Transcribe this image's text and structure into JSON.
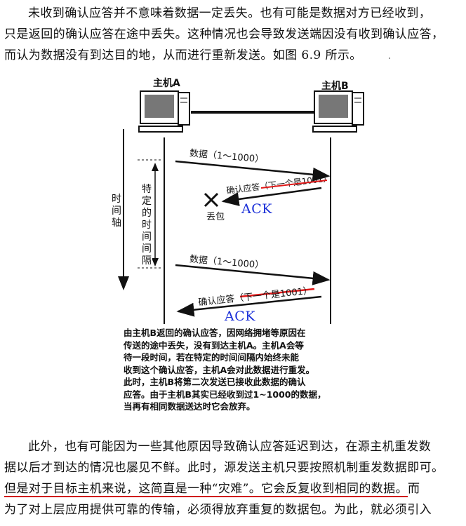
{
  "paragraph1": {
    "lines": [
      "未收到确认应答并不意味着数据一定丢失。也有可能是数据对方已经收到，",
      "只是返回的确认应答在途中丢失。这种情况也会导致发送端因没有收到确认应答，",
      "而认为数据没有到达目的地，从而进行重新发送。如图 6.9 所示。"
    ]
  },
  "diagram": {
    "host_a": "主机A",
    "host_b": "主机B",
    "time_axis": [
      "时",
      "间",
      "轴"
    ],
    "interval": [
      "特",
      "定",
      "的",
      "时",
      "间",
      "间",
      "隔"
    ],
    "data1": "数据（1～1000）",
    "ack1": "确认应答（下一个是1001）",
    "lost": "丢包",
    "ack_note1": "ACK",
    "data2": "数据（1～1000）",
    "ack2": "确认应答（下一个是1001）",
    "ack_note2": "ACK",
    "ack_color": "#1a2fd8",
    "strike_color": "#e01818"
  },
  "caption": {
    "lines": [
      "由主机B返回的确认应答，因网络拥堵等原因在",
      "传送的途中丢失，没有到达主机A。主机A会等",
      "待一段时间，若在特定的时间间隔内始终未能",
      "收到这个确认应答，主机A会对此数据进行重发。",
      "此时，主机B将第二次发送已接收此数据的确认",
      "应答。由于主机B其实已经收到过1~1000的数据，",
      "当再有相同数据送达时它会放弃。"
    ]
  },
  "paragraph2": {
    "line1": "此外，也有可能因为一些其他原因导致确认应答延迟到达，在源主机重发数",
    "line2": "据以后才到达的情况也屡见不鲜。此时，源发送主机只要按照机制重发数据即可。",
    "line3_underlined": "但是对于目标主机来说，这简直是一种“灾难”。它会反复收到相同的数据。",
    "line3_rest": "而",
    "line4": "为了对上层应用提供可靠的传输，必须得放弃重复的数据包。为此，就必须引入",
    "underline_color": "#d01010"
  }
}
